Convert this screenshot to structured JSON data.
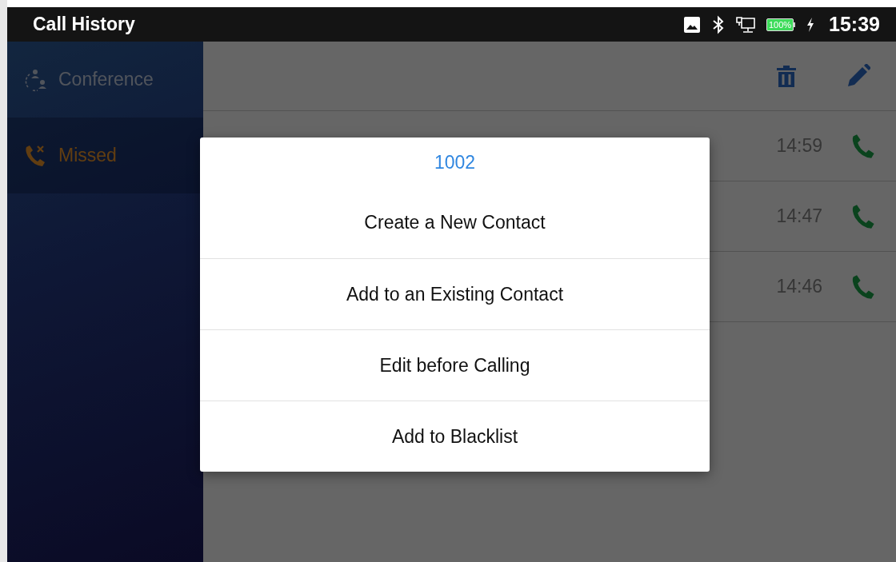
{
  "status_bar": {
    "title": "Call History",
    "battery": "100%",
    "time": "15:39"
  },
  "sidebar": {
    "items": [
      {
        "kind": "conference",
        "label": "Conference",
        "selected": false
      },
      {
        "kind": "missed",
        "label": "Missed",
        "selected": true
      }
    ]
  },
  "calls": [
    {
      "time": "14:59"
    },
    {
      "time": "14:47"
    },
    {
      "time": "14:46"
    }
  ],
  "dialog": {
    "title": "1002",
    "options": [
      "Create a New Contact",
      "Add to an Existing Contact",
      "Edit before Calling",
      "Add to Blacklist"
    ]
  }
}
